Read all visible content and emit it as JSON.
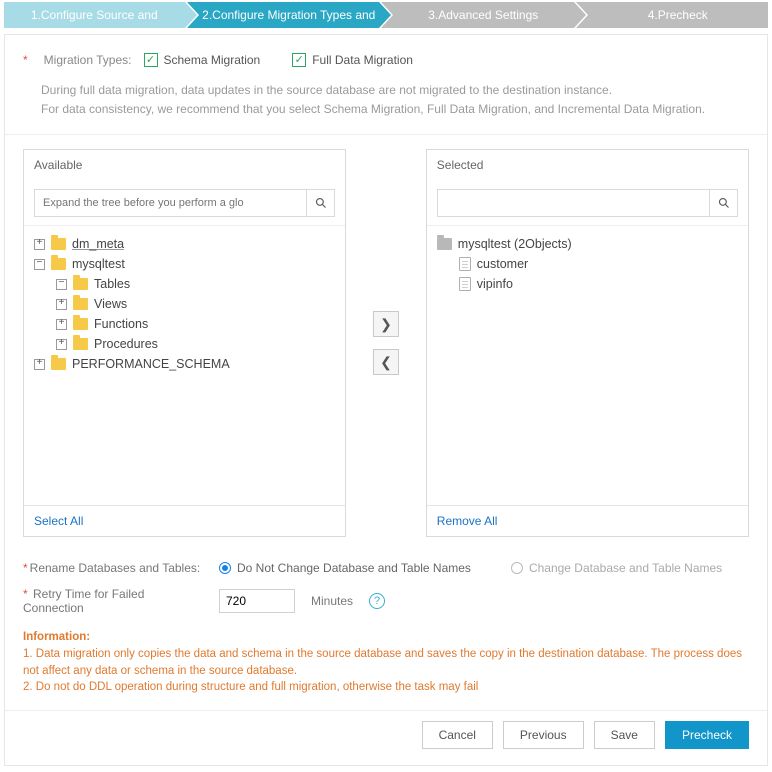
{
  "steps": [
    {
      "label": "1.Configure Source and",
      "state": "done"
    },
    {
      "label": "2.Configure Migration Types and",
      "state": "active"
    },
    {
      "label": "3.Advanced Settings",
      "state": ""
    },
    {
      "label": "4.Precheck",
      "state": ""
    }
  ],
  "migrationTypes": {
    "label": "Migration Types:",
    "options": {
      "schema": {
        "text": "Schema Migration",
        "checked": true
      },
      "full": {
        "text": "Full Data Migration",
        "checked": true
      }
    },
    "desc1": "During full data migration, data updates in the source database are not migrated to the destination instance.",
    "desc2": "For data consistency, we recommend that you select Schema Migration, Full Data Migration, and Incremental Data Migration."
  },
  "available": {
    "title": "Available",
    "searchPlaceholder": "Expand the tree before you perform a glo",
    "selectAll": "Select All",
    "tree": {
      "dm_meta": "dm_meta",
      "mysqltest": "mysqltest",
      "tables": "Tables",
      "views": "Views",
      "functions": "Functions",
      "procedures": "Procedures",
      "perf": "PERFORMANCE_SCHEMA"
    }
  },
  "selected": {
    "title": "Selected",
    "removeAll": "Remove All",
    "db": "mysqltest (2Objects)",
    "items": {
      "customer": "customer",
      "vipinfo": "vipinfo"
    }
  },
  "rename": {
    "label": "Rename Databases and Tables:",
    "opt1": "Do Not Change Database and Table Names",
    "opt2": "Change Database and Table Names"
  },
  "retry": {
    "label": "Retry Time for Failed Connection",
    "value": "720",
    "unit": "Minutes"
  },
  "info": {
    "title": "Information:",
    "l1": "1. Data migration only copies the data and schema in the source database and saves the copy in the destination database. The process does not affect any data or schema in the source database.",
    "l2": "2. Do not do DDL operation during structure and full migration, otherwise the task may fail"
  },
  "buttons": {
    "cancel": "Cancel",
    "previous": "Previous",
    "save": "Save",
    "precheck": "Precheck"
  }
}
